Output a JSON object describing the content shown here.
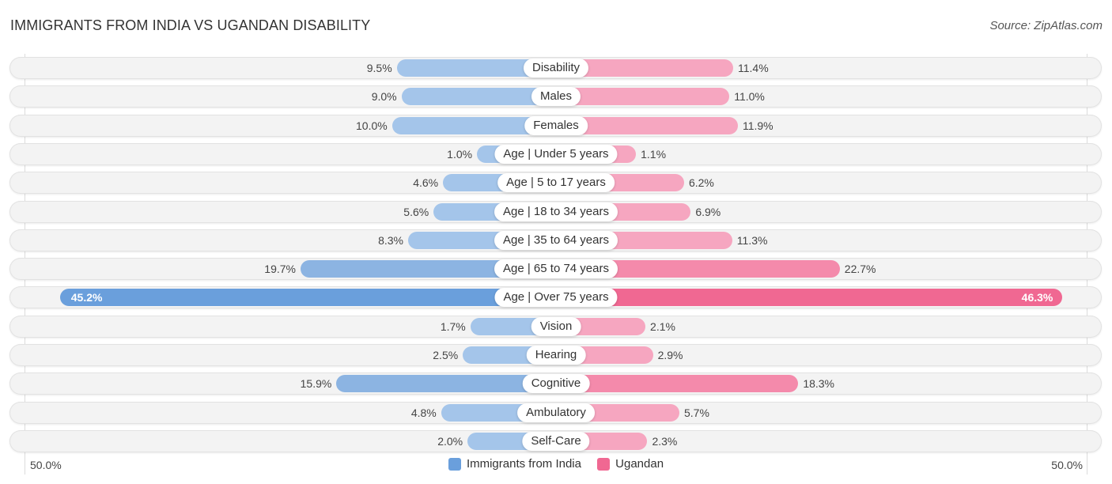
{
  "header": {
    "title": "IMMIGRANTS FROM INDIA VS UGANDAN DISABILITY",
    "source": "Source: ZipAtlas.com"
  },
  "colors": {
    "india": "#6a9fdc",
    "ugandan": "#f06892"
  },
  "chart_data": {
    "type": "bar",
    "orientation": "horizontal-diverging",
    "title": "IMMIGRANTS FROM INDIA VS UGANDAN DISABILITY",
    "categories": [
      "Disability",
      "Males",
      "Females",
      "Age | Under 5 years",
      "Age | 5 to 17 years",
      "Age | 18 to 34 years",
      "Age | 35 to 64 years",
      "Age | 65 to 74 years",
      "Age | Over 75 years",
      "Vision",
      "Hearing",
      "Cognitive",
      "Ambulatory",
      "Self-Care"
    ],
    "series": [
      {
        "name": "Immigrants from India",
        "side": "left",
        "values": [
          9.5,
          9.0,
          10.0,
          1.0,
          4.6,
          5.6,
          8.3,
          19.7,
          45.2,
          1.7,
          2.5,
          15.9,
          4.8,
          2.0
        ],
        "labels": [
          "9.5%",
          "9.0%",
          "10.0%",
          "1.0%",
          "4.6%",
          "5.6%",
          "8.3%",
          "19.7%",
          "45.2%",
          "1.7%",
          "2.5%",
          "15.9%",
          "4.8%",
          "2.0%"
        ]
      },
      {
        "name": "Ugandan",
        "side": "right",
        "values": [
          11.4,
          11.0,
          11.9,
          1.1,
          6.2,
          6.9,
          11.3,
          22.7,
          46.3,
          2.1,
          2.9,
          18.3,
          5.7,
          2.3
        ],
        "labels": [
          "11.4%",
          "11.0%",
          "11.9%",
          "1.1%",
          "6.2%",
          "6.9%",
          "11.3%",
          "22.7%",
          "46.3%",
          "2.1%",
          "2.9%",
          "18.3%",
          "5.7%",
          "2.3%"
        ]
      }
    ],
    "xlim": [
      -50,
      50
    ],
    "axis_left_label": "50.0%",
    "axis_right_label": "50.0%",
    "legend": [
      "Immigrants from India",
      "Ugandan"
    ],
    "legend_position": "bottom-center",
    "grid": false
  },
  "legend": {
    "india": "Immigrants from India",
    "ugandan": "Ugandan"
  },
  "axis": {
    "left": "50.0%",
    "right": "50.0%"
  }
}
